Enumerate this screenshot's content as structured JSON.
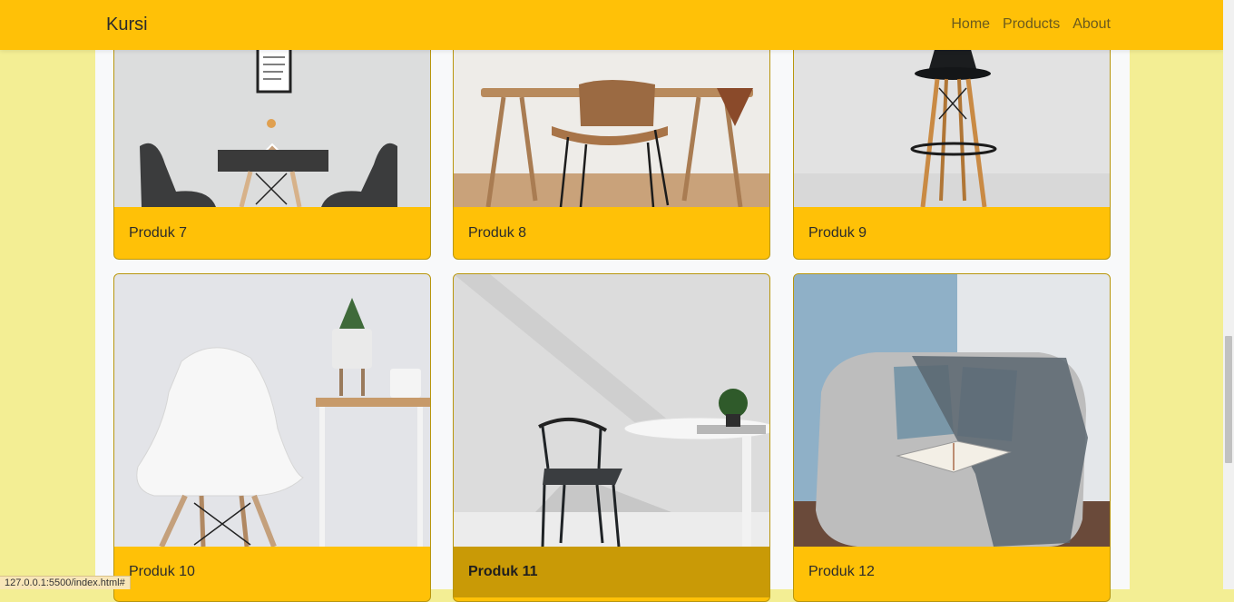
{
  "navbar": {
    "brand": "Kursi",
    "links": [
      "Home",
      "Products",
      "About"
    ]
  },
  "products": [
    {
      "name": "Produk 7"
    },
    {
      "name": "Produk 8"
    },
    {
      "name": "Produk 9"
    },
    {
      "name": "Produk 10"
    },
    {
      "name": "Produk 11"
    },
    {
      "name": "Produk 12"
    }
  ],
  "status_bar": {
    "url": "127.0.0.1:5500/index.html#"
  },
  "colors": {
    "navbar": "#ffc107",
    "background": "#f3ee94",
    "card_footer": "#ffc107",
    "card_footer_hover": "#c99a06"
  }
}
